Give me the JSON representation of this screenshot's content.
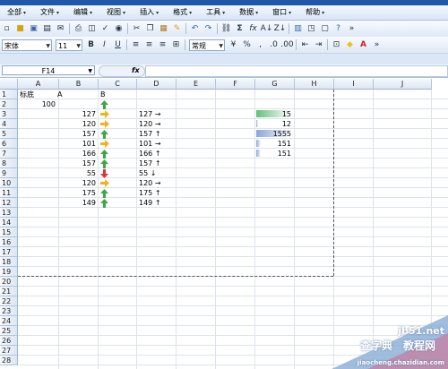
{
  "menu": [
    {
      "label": "全部",
      "arrow": "▾"
    },
    {
      "label": "文件",
      "arrow": "▾"
    },
    {
      "label": "编辑",
      "arrow": "▾"
    },
    {
      "label": "视图",
      "arrow": "▾"
    },
    {
      "label": "插入",
      "arrow": "▾"
    },
    {
      "label": "格式",
      "arrow": "▾"
    },
    {
      "label": "工具",
      "arrow": "▾"
    },
    {
      "label": "数据",
      "arrow": "▾"
    },
    {
      "label": "窗口",
      "arrow": "▾"
    },
    {
      "label": "帮助",
      "arrow": "▾"
    }
  ],
  "font_name": "宋体",
  "font_size": "11",
  "number_format": "常规",
  "toolbar_glyphs": {
    "bold": "B",
    "italic": "I",
    "underline": "U",
    "sum": "Σ",
    "fx": "fx",
    "percent": "%",
    "comma": ",",
    "sort": "A↓",
    "undo": "↶",
    "redo": "↷"
  },
  "name_box": "F14",
  "fx_label": "fx",
  "columns": [
    "A",
    "B",
    "C",
    "D",
    "E",
    "F",
    "G",
    "H",
    "I",
    "J"
  ],
  "rows": [
    "1",
    "2",
    "3",
    "4",
    "5",
    "6",
    "7",
    "8",
    "9",
    "10",
    "11",
    "12",
    "13",
    "14",
    "15",
    "16",
    "17",
    "18",
    "19",
    "20",
    "21",
    "22",
    "23",
    "24",
    "25",
    "26",
    "27",
    "28"
  ],
  "cells": {
    "A1": "标底",
    "A1b": "A",
    "B1": "B",
    "A2": "100",
    "B": [
      "127",
      "120",
      "157",
      "101",
      "166",
      "157",
      "55",
      "120",
      "175",
      "149"
    ],
    "D": [
      "127 →",
      "120 →",
      "157 ↑",
      "101 →",
      "166 ↑",
      "157 ↑",
      "55 ↓",
      "120 →",
      "175 ↑",
      "149 ↑"
    ],
    "G": [
      "15",
      "12",
      "1555",
      "151",
      "151"
    ]
  },
  "C_icons": [
    "right",
    "right",
    "up",
    "right",
    "up",
    "up",
    "down",
    "right",
    "up",
    "up"
  ],
  "C2_icon": "up",
  "icon_colors": {
    "up": "#3aa845",
    "right": "#f2b21c",
    "down": "#e0343a"
  },
  "databar": {
    "fill": [
      0.95,
      0.04,
      1.0,
      0.12,
      0.12
    ],
    "color": "#63be7b",
    "color2": "#8aa6d6"
  },
  "watermark": {
    "line1": "jb51.net",
    "line2": "查字典",
    "line3": "教程网",
    "line4": "jiaocheng.chazidian.com"
  }
}
